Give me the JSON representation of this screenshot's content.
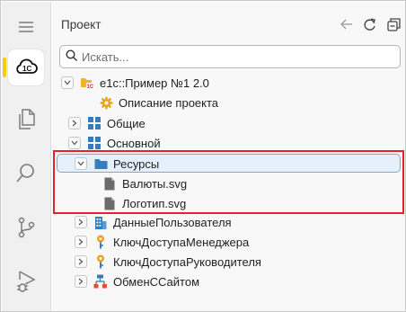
{
  "panel": {
    "title": "Проект",
    "search_placeholder": "Искать..."
  },
  "activity_bar": [
    {
      "name": "menu-icon"
    },
    {
      "name": "cloud-1c-icon",
      "active": true
    },
    {
      "name": "copy-files-icon"
    },
    {
      "name": "search-icon"
    },
    {
      "name": "source-control-icon"
    },
    {
      "name": "run-debug-icon"
    }
  ],
  "header_actions": [
    {
      "name": "back-arrow-icon"
    },
    {
      "name": "refresh-icon"
    },
    {
      "name": "collapse-all-icon"
    }
  ],
  "tree": [
    {
      "label": "e1c::Пример №1 2.0",
      "icon": "project-folder-1c-icon",
      "expanded": true
    },
    {
      "label": "Описание проекта",
      "icon": "gear-icon"
    },
    {
      "label": "Общие",
      "icon": "module-grid-icon",
      "expanded": false
    },
    {
      "label": "Основной",
      "icon": "module-grid-icon",
      "expanded": true
    },
    {
      "label": "Ресурсы",
      "icon": "folder-icon",
      "expanded": true,
      "selected": true
    },
    {
      "label": "Валюты.svg",
      "icon": "file-icon"
    },
    {
      "label": "Логотип.svg",
      "icon": "file-icon"
    },
    {
      "label": "ДанныеПользователя",
      "icon": "building-icon",
      "expanded": false
    },
    {
      "label": "КлючДоступаМенеджера",
      "icon": "key-pin-icon",
      "expanded": false
    },
    {
      "label": "КлючДоступаРуководителя",
      "icon": "key-pin-icon",
      "expanded": false
    },
    {
      "label": "ОбменССайтом",
      "icon": "exchange-icon",
      "expanded": false
    }
  ],
  "colors": {
    "accent_yellow": "#f5d000",
    "selection_bg": "#e6f0fa",
    "selection_border": "#7ca8d8",
    "highlight_red": "#e0242a",
    "icon_blue": "#2f7fc1",
    "icon_orange": "#f0a020"
  }
}
